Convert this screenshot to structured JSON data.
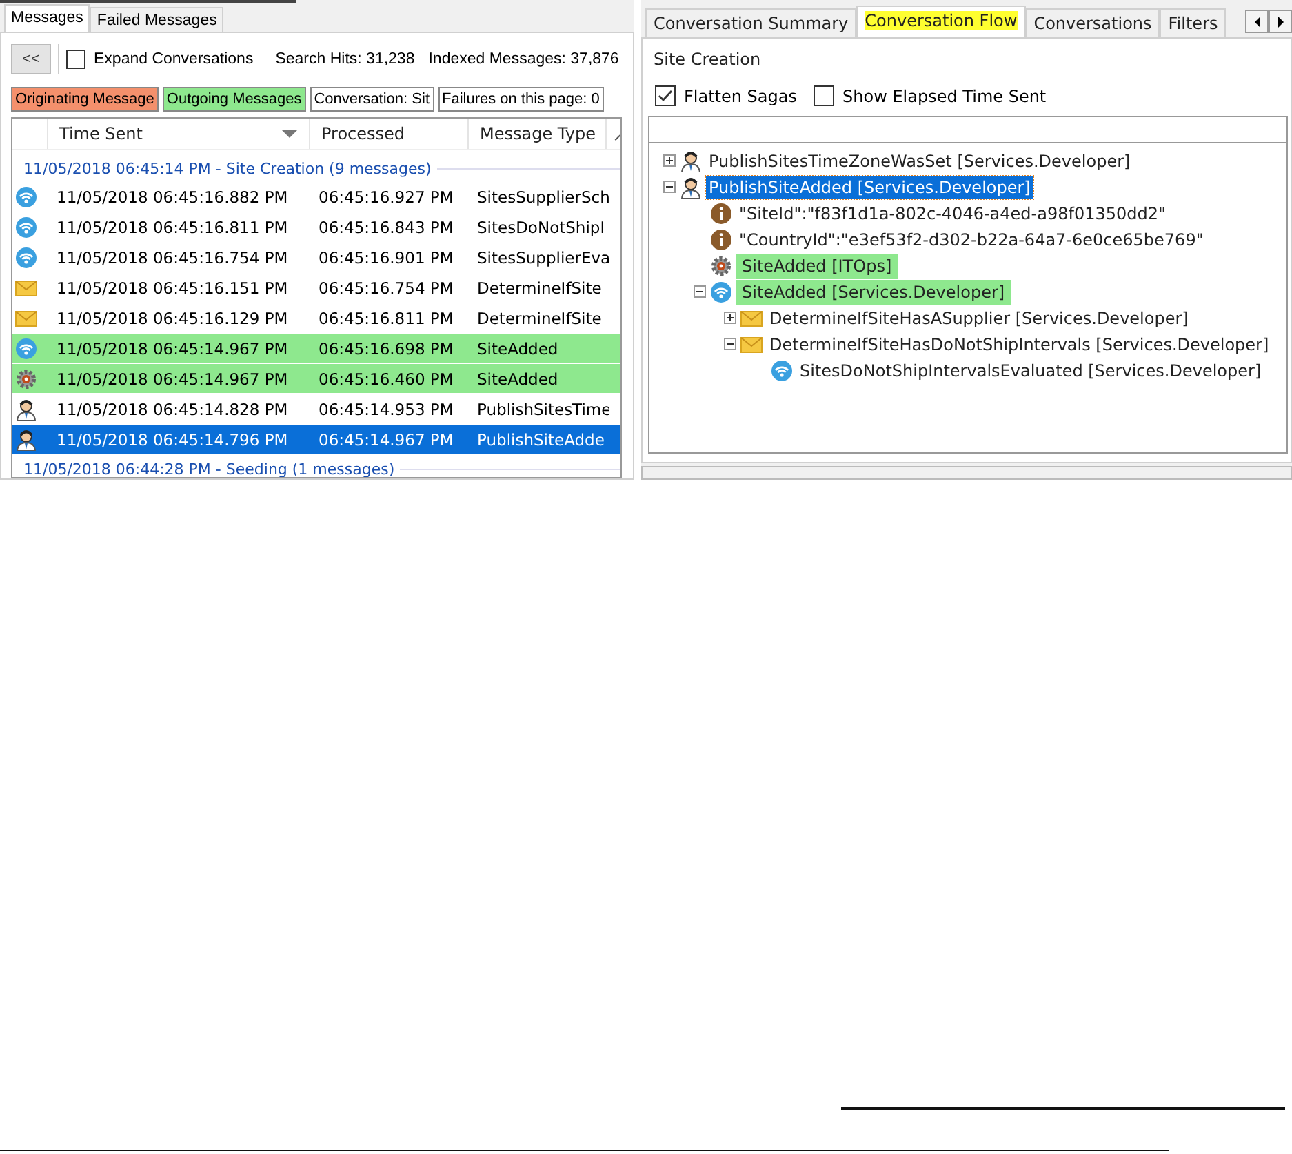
{
  "left_tabs": [
    {
      "label": "Messages",
      "selected": true
    },
    {
      "label": "Failed Messages",
      "selected": false
    }
  ],
  "toolbar": {
    "collapse_button": "<<",
    "expand_conversations": {
      "label": "Expand Conversations",
      "checked": false
    },
    "search_hits": "Search Hits: 31,238",
    "indexed_messages": "Indexed Messages: 37,876"
  },
  "legend": [
    {
      "label": "Originating Message",
      "color": "#f4906c"
    },
    {
      "label": "Outgoing Messages",
      "color": "#8ee88e"
    },
    {
      "label": "Conversation: Sit",
      "color": "#ffffff"
    },
    {
      "label": "Failures on this page: 0",
      "color": "#ffffff"
    }
  ],
  "table": {
    "columns": [
      "Time Sent",
      "Processed",
      "Message Type"
    ],
    "groups": [
      {
        "header": "11/05/2018 06:45:14 PM - Site Creation (9 messages)",
        "rows": [
          {
            "kind": "event",
            "time_sent": "11/05/2018 06:45:16.882 PM",
            "processed": "06:45:16.927 PM",
            "message_type": "SitesSupplierSch",
            "outgoing": false,
            "selected": false
          },
          {
            "kind": "event",
            "time_sent": "11/05/2018 06:45:16.811 PM",
            "processed": "06:45:16.843 PM",
            "message_type": "SitesDoNotShipI",
            "outgoing": false,
            "selected": false
          },
          {
            "kind": "event",
            "time_sent": "11/05/2018 06:45:16.754 PM",
            "processed": "06:45:16.901 PM",
            "message_type": "SitesSupplierEva",
            "outgoing": false,
            "selected": false
          },
          {
            "kind": "command",
            "time_sent": "11/05/2018 06:45:16.151 PM",
            "processed": "06:45:16.754 PM",
            "message_type": "DetermineIfSite",
            "outgoing": false,
            "selected": false
          },
          {
            "kind": "command",
            "time_sent": "11/05/2018 06:45:16.129 PM",
            "processed": "06:45:16.811 PM",
            "message_type": "DetermineIfSite",
            "outgoing": false,
            "selected": false
          },
          {
            "kind": "event",
            "time_sent": "11/05/2018 06:45:14.967 PM",
            "processed": "06:45:16.698 PM",
            "message_type": "SiteAdded",
            "outgoing": true,
            "selected": false
          },
          {
            "kind": "saga",
            "time_sent": "11/05/2018 06:45:14.967 PM",
            "processed": "06:45:16.460 PM",
            "message_type": "SiteAdded",
            "outgoing": true,
            "selected": false
          },
          {
            "kind": "user",
            "time_sent": "11/05/2018 06:45:14.828 PM",
            "processed": "06:45:14.953 PM",
            "message_type": "PublishSitesTime",
            "outgoing": false,
            "selected": false
          },
          {
            "kind": "user",
            "time_sent": "11/05/2018 06:45:14.796 PM",
            "processed": "06:45:14.967 PM",
            "message_type": "PublishSiteAdde",
            "outgoing": false,
            "selected": true
          }
        ]
      },
      {
        "header": "11/05/2018 06:44:28 PM - Seeding (1 messages)"
      }
    ]
  },
  "right_tabs": [
    {
      "label": "Conversation Summary",
      "selected": false
    },
    {
      "label": "Conversation Flow",
      "selected": true
    },
    {
      "label": "Conversations",
      "selected": false
    },
    {
      "label": "Filters",
      "selected": false
    }
  ],
  "conversation_title": "Site Creation",
  "options": [
    {
      "label": "Flatten Sagas",
      "checked": true
    },
    {
      "label": "Show Elapsed Time Sent",
      "checked": false
    }
  ],
  "tree": [
    {
      "kind": "user",
      "label": "PublishSitesTimeZoneWasSet [Services.Developer]",
      "expanded": false,
      "selected": false,
      "outgoing": false
    },
    {
      "kind": "user",
      "label": "PublishSiteAdded [Services.Developer]",
      "expanded": true,
      "selected": true,
      "outgoing": false,
      "children": [
        {
          "kind": "info",
          "label": "\"SiteId\":\"f83f1d1a-802c-4046-a4ed-a98f01350dd2\"",
          "selected": false,
          "outgoing": false
        },
        {
          "kind": "info",
          "label": "\"CountryId\":\"e3ef53f2-d302-b22a-64a7-6e0ce65be769\"",
          "selected": false,
          "outgoing": false
        },
        {
          "kind": "saga",
          "label": "SiteAdded [ITOps]",
          "selected": false,
          "outgoing": true
        },
        {
          "kind": "event",
          "label": "SiteAdded [Services.Developer]",
          "expanded": true,
          "selected": false,
          "outgoing": true,
          "children": [
            {
              "kind": "command",
              "label": "DetermineIfSiteHasASupplier [Services.Developer]",
              "expanded": false,
              "selected": false,
              "outgoing": false
            },
            {
              "kind": "command",
              "label": "DetermineIfSiteHasDoNotShipIntervals [Services.Developer]",
              "expanded": true,
              "selected": false,
              "outgoing": false,
              "children": [
                {
                  "kind": "event",
                  "label": "SitesDoNotShipIntervalsEvaluated [Services.Developer]",
                  "selected": false,
                  "outgoing": false
                }
              ]
            }
          ]
        }
      ]
    }
  ]
}
